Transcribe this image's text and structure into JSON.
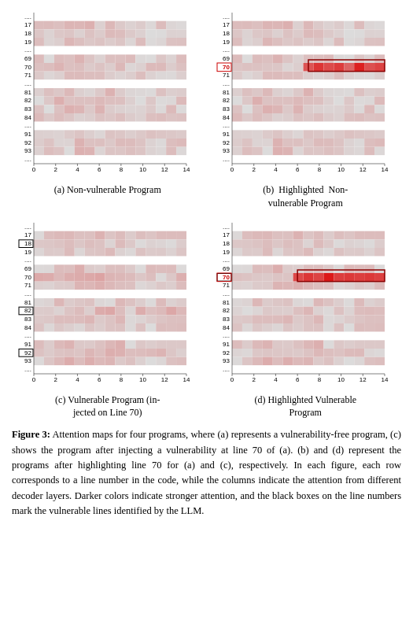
{
  "figures": [
    {
      "id": "a",
      "label": "(a) Non-vulnerable Program",
      "has_highlight": false,
      "vulnerable": false,
      "highlight_rows": [],
      "box_rows": [],
      "hot_region": null
    },
    {
      "id": "b",
      "label": "(b)  Highlighted  Non-vulnerable Program",
      "has_highlight": true,
      "vulnerable": false,
      "highlight_rows": [
        70
      ],
      "box_rows": [],
      "hot_region": {
        "row": 70,
        "col_start": 7,
        "col_end": 14,
        "intensity": "high"
      }
    },
    {
      "id": "c",
      "label": "(c) Vulnerable Program (injected on Line 70)",
      "has_highlight": false,
      "vulnerable": true,
      "highlight_rows": [],
      "box_rows": [
        18,
        82,
        92
      ],
      "hot_region": null
    },
    {
      "id": "d",
      "label": "(d) Highlighted Vulnerable Program",
      "has_highlight": true,
      "vulnerable": true,
      "highlight_rows": [
        70
      ],
      "box_rows": [
        70
      ],
      "hot_region": {
        "row": 70,
        "col_start": 6,
        "col_end": 14,
        "intensity": "high"
      }
    }
  ],
  "figure_caption": "Figure 3: Attention maps for four programs, where (a) represents a vulnerability-free program, (c) shows the program after injecting a vulnerability at line 70 of (a). (b) and (d) represent the programs after highlighting line 70 for (a) and (c), respectively. In each figure, each row corresponds to a line number in the code, while the columns indicate the attention from different decoder layers. Darker colors indicate stronger attention, and the black boxes on the line numbers mark the vulnerable lines identified by the LLM.",
  "rows": [
    17,
    18,
    19,
    "...",
    69,
    70,
    71,
    "...",
    81,
    82,
    83,
    84,
    "...",
    91,
    92,
    93,
    "..."
  ],
  "x_ticks": [
    0,
    2,
    4,
    6,
    8,
    10,
    12,
    14
  ]
}
